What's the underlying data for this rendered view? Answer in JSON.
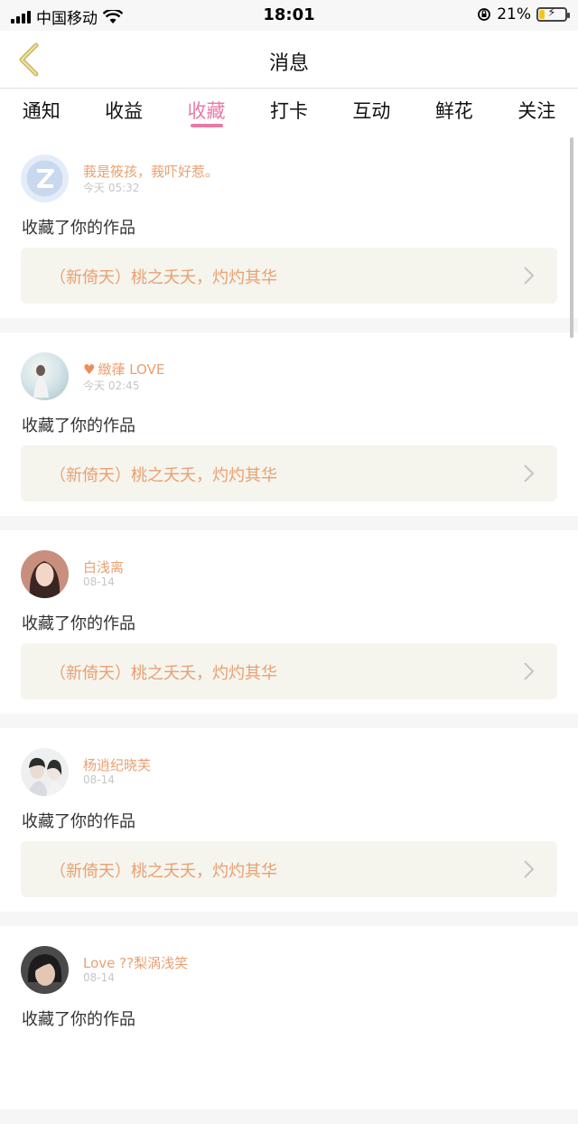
{
  "status": {
    "carrier": "中国移动",
    "time": "18:01",
    "battery": "21%",
    "battery_level": 0.21
  },
  "nav": {
    "title": "消息"
  },
  "tabs": [
    {
      "label": "通知"
    },
    {
      "label": "收益"
    },
    {
      "label": "收藏",
      "active": true
    },
    {
      "label": "打卡"
    },
    {
      "label": "互动"
    },
    {
      "label": "鲜花"
    },
    {
      "label": "关注"
    }
  ],
  "messages": [
    {
      "user": "莪是筱孩，莪吓好惹。",
      "time": "今天 05:32",
      "action": "收藏了你的作品",
      "work": "（新倚天）桃之夭夭，灼灼其华"
    },
    {
      "user": "緻葎 LOVE",
      "time": "今天 02:45",
      "action": "收藏了你的作品",
      "work": "（新倚天）桃之夭夭，灼灼其华"
    },
    {
      "user": "白浅离",
      "time": "08-14",
      "action": "收藏了你的作品",
      "work": "（新倚天）桃之夭夭，灼灼其华"
    },
    {
      "user": "杨逍纪晓芙",
      "time": "08-14",
      "action": "收藏了你的作品",
      "work": "（新倚天）桃之夭夭，灼灼其华"
    },
    {
      "user": "Love ??梨涡浅笑",
      "time": "08-14",
      "action": "收藏了你的作品",
      "work": ""
    }
  ],
  "colors": {
    "accent": "#e87aa6",
    "username": "#e9a071",
    "work_bg": "#f5f5ee"
  }
}
